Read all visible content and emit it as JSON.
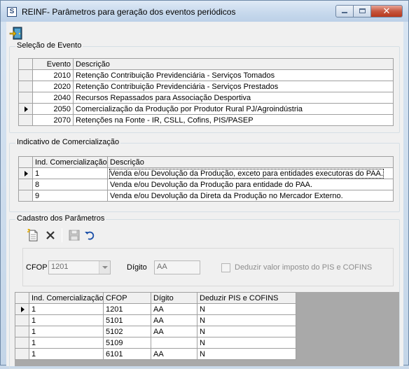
{
  "window": {
    "title": "REINF- Parâmetros para geração dos eventos periódicos",
    "icon_letter": "S",
    "close_label": "✕"
  },
  "evento_group": {
    "label": "Seleção de Evento",
    "columns": [
      "Evento",
      "Descrição"
    ],
    "rows": [
      {
        "evento": "2010",
        "descricao": "Retenção Contribuição Previdenciária - Serviços Tomados"
      },
      {
        "evento": "2020",
        "descricao": "Retenção Contribuição Previdenciária - Serviços Prestados"
      },
      {
        "evento": "2040",
        "descricao": "Recursos Repassados para Associação Desportiva"
      },
      {
        "evento": "2050",
        "descricao": "Comercialização da Produção por Produtor Rural PJ/Agroindústria"
      },
      {
        "evento": "2070",
        "descricao": "Retenções na Fonte - IR, CSLL, Cofins, PIS/PASEP"
      }
    ],
    "selected_index": 3
  },
  "indicativo_group": {
    "label": "Indicativo de Comercialização",
    "columns": [
      "Ind. Comercialização",
      "Descrição"
    ],
    "rows": [
      {
        "ind": "1",
        "descricao": "Venda e/ou Devolução da Produção, exceto para entidades executoras do PAA."
      },
      {
        "ind": "8",
        "descricao": "Venda e/ou Devolução da Produção para entidade do PAA."
      },
      {
        "ind": "9",
        "descricao": "Venda e/ou Devolução da Direta da Produção no Mercador Externo."
      }
    ],
    "selected_index": 0
  },
  "cadastro_group": {
    "label": "Cadastro dos Parâmetros",
    "toolbar": {
      "new_icon": "new-document-icon",
      "delete_icon": "delete-x-icon",
      "save_icon": "save-disk-icon",
      "undo_icon": "undo-arrow-icon"
    },
    "form": {
      "cfop_label": "CFOP",
      "cfop_value": "1201",
      "digito_label": "Dígito",
      "digito_value": "AA",
      "deduzir_label": "Deduzir valor imposto do PIS e COFINS",
      "deduzir_checked": false
    },
    "grid": {
      "columns": [
        "Ind. Comercialização",
        "CFOP",
        "Dígito",
        "Deduzir PIS e COFINS"
      ],
      "rows": [
        {
          "ind": "1",
          "cfop": "1201",
          "digito": "AA",
          "deduzir": "N"
        },
        {
          "ind": "1",
          "cfop": "5101",
          "digito": "AA",
          "deduzir": "N"
        },
        {
          "ind": "1",
          "cfop": "5102",
          "digito": "AA",
          "deduzir": "N"
        },
        {
          "ind": "1",
          "cfop": "5109",
          "digito": "",
          "deduzir": "N"
        },
        {
          "ind": "1",
          "cfop": "6101",
          "digito": "AA",
          "deduzir": "N"
        }
      ],
      "selected_index": 0
    }
  }
}
